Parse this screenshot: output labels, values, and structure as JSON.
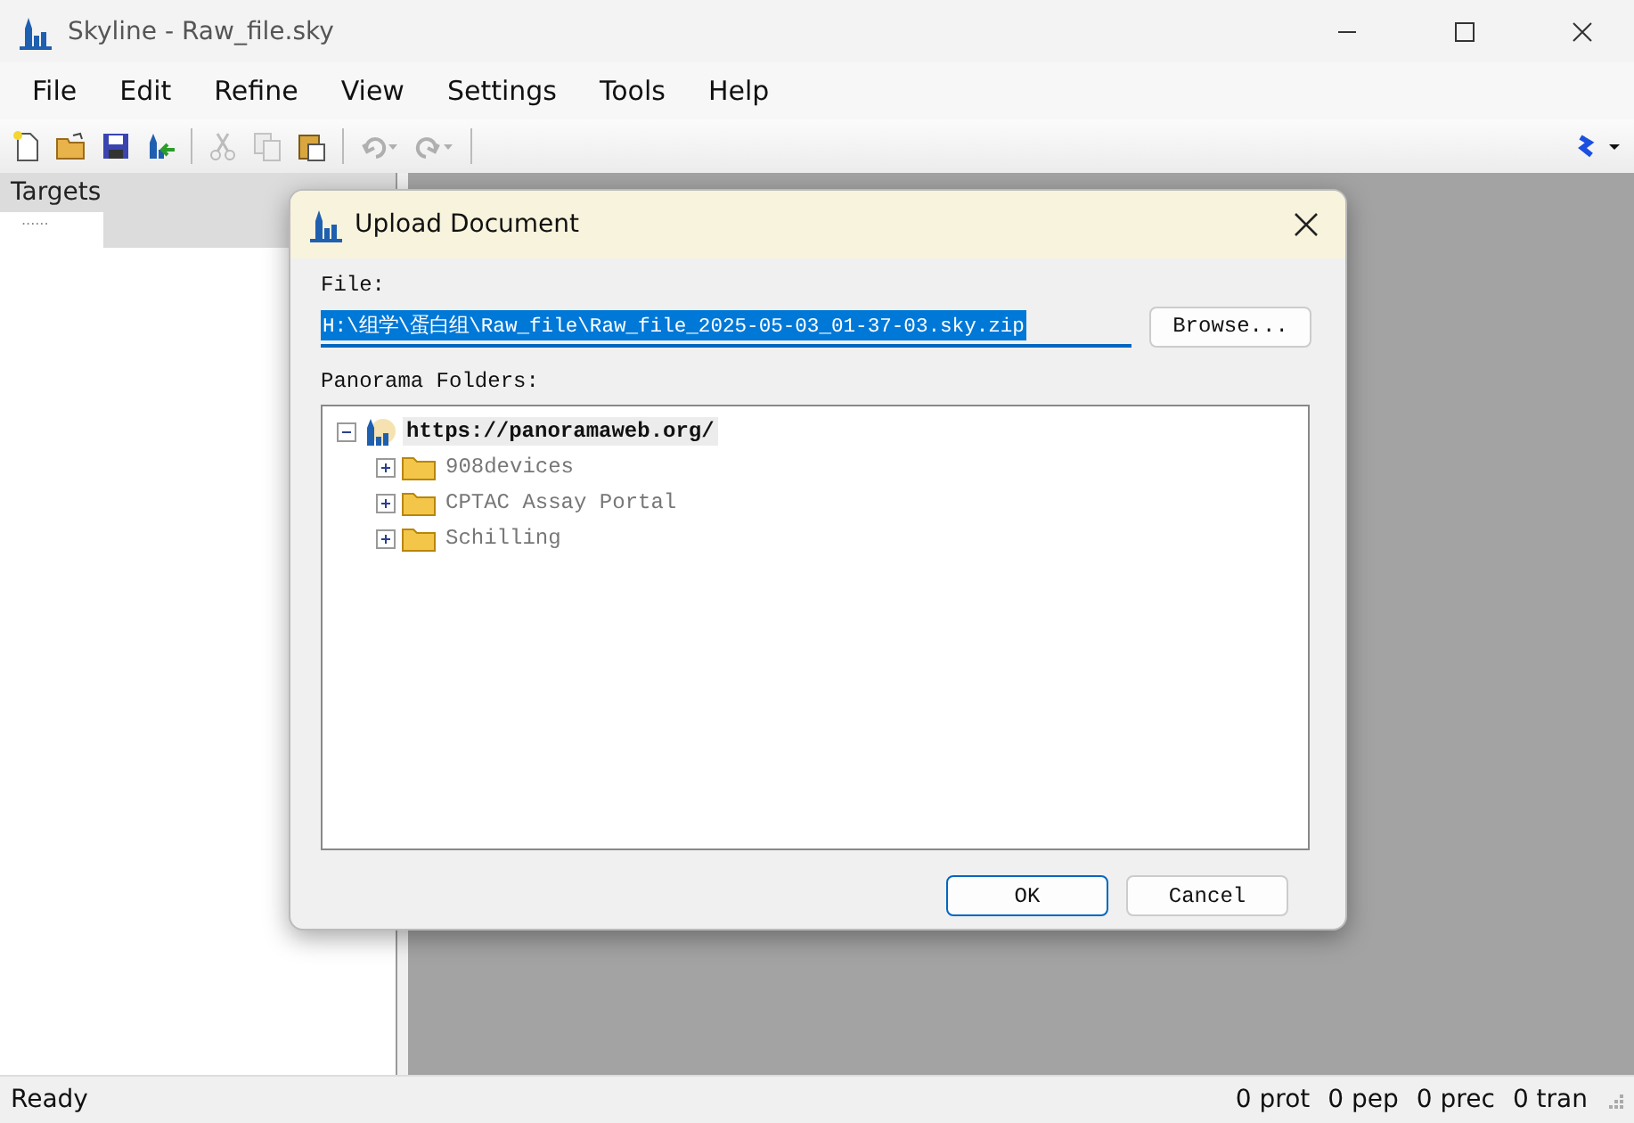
{
  "window": {
    "title": "Skyline - Raw_file.sky"
  },
  "menu": [
    "File",
    "Edit",
    "Refine",
    "View",
    "Settings",
    "Tools",
    "Help"
  ],
  "toolbar": [
    {
      "kind": "new",
      "disabled": false
    },
    {
      "kind": "open",
      "disabled": false
    },
    {
      "kind": "save",
      "disabled": false
    },
    {
      "kind": "publish",
      "disabled": false
    },
    {
      "kind": "separator"
    },
    {
      "kind": "cut",
      "disabled": true
    },
    {
      "kind": "copy",
      "disabled": true
    },
    {
      "kind": "paste",
      "disabled": false
    },
    {
      "kind": "separator"
    },
    {
      "kind": "undo",
      "disabled": true
    },
    {
      "kind": "redo",
      "disabled": true
    },
    {
      "kind": "separator"
    }
  ],
  "targets_panel": {
    "title": "Targets",
    "stub": "......"
  },
  "dialog": {
    "title": "Upload Document",
    "file_label": "File:",
    "file_value": "H:\\组学\\蛋白组\\Raw_file\\Raw_file_2025-05-03_01-37-03.sky.zip",
    "browse": "Browse...",
    "folders_label": "Panorama Folders:",
    "tree": [
      {
        "label": "https://panoramaweb.org/",
        "kind": "server",
        "expanded": true,
        "selected": true,
        "children": [
          {
            "label": "908devices",
            "kind": "folder",
            "expanded": false,
            "selected": false
          },
          {
            "label": "CPTAC Assay Portal",
            "kind": "folder",
            "expanded": false,
            "selected": false
          },
          {
            "label": "Schilling",
            "kind": "folder",
            "expanded": false,
            "selected": false
          }
        ]
      }
    ],
    "ok": "OK",
    "cancel": "Cancel"
  },
  "status_bar": {
    "left": "Ready",
    "counts": [
      "0 prot",
      "0 pep",
      "0 prec",
      "0 tran"
    ]
  }
}
